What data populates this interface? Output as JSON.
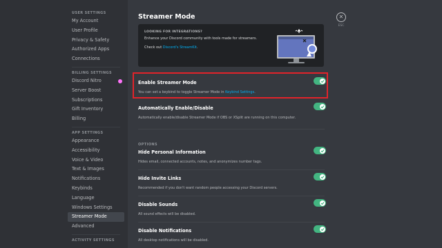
{
  "sidebar": {
    "sections": [
      {
        "title": "USER SETTINGS",
        "items": [
          "My Account",
          "User Profile",
          "Privacy & Safety",
          "Authorized Apps",
          "Connections"
        ]
      },
      {
        "title": "BILLING SETTINGS",
        "items": [
          "Discord Nitro",
          "Server Boost",
          "Subscriptions",
          "Gift Inventory",
          "Billing"
        ]
      },
      {
        "title": "APP SETTINGS",
        "items": [
          "Appearance",
          "Accessibility",
          "Voice & Video",
          "Text & Images",
          "Notifications",
          "Keybinds",
          "Language",
          "Windows Settings",
          "Streamer Mode",
          "Advanced"
        ]
      },
      {
        "title": "ACTIVITY SETTINGS",
        "items": []
      }
    ],
    "selected": "Streamer Mode"
  },
  "page": {
    "title": "Streamer Mode",
    "close_label": "ESC"
  },
  "banner": {
    "title": "LOOKING FOR INTEGRATIONS?",
    "description": "Enhance your Discord community with tools made for streamers.",
    "check_prefix": "Check out ",
    "check_link": "Discord's StreamKit",
    "check_suffix": "."
  },
  "settings": {
    "enable": {
      "title": "Enable Streamer Mode",
      "desc_prefix": "You can set a keybind to toggle Streamer Mode in ",
      "desc_link": "Keybind Settings",
      "desc_suffix": ".",
      "enabled": true
    },
    "auto": {
      "title": "Automatically Enable/Disable",
      "desc": "Automatically enable/disable Streamer Mode if OBS or XSplit are running on this computer.",
      "enabled": true
    },
    "options_label": "OPTIONS",
    "hide_personal": {
      "title": "Hide Personal Information",
      "desc": "Hides email, connected accounts, notes, and anonymizes number tags.",
      "enabled": true
    },
    "hide_invite": {
      "title": "Hide Invite Links",
      "desc": "Recommended if you don't want random people accessing your Discord servers.",
      "enabled": true
    },
    "disable_sounds": {
      "title": "Disable Sounds",
      "desc": "All sound effects will be disabled.",
      "enabled": true
    },
    "disable_notifications": {
      "title": "Disable Notifications",
      "desc": "All desktop notifications will be disabled.",
      "enabled": true
    }
  },
  "colors": {
    "accent_toggle": "#43b581",
    "link": "#00b0f4",
    "highlight": "#e3232a"
  }
}
